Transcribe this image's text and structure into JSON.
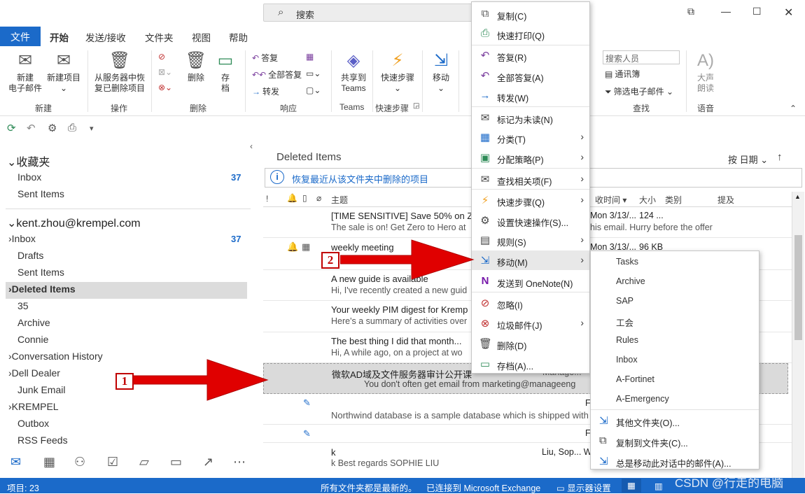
{
  "titlebar": {
    "search_placeholder": "搜索",
    "icons": [
      "magnifier-icon",
      "restore-icon",
      "minimize-icon",
      "maximize-icon",
      "close-icon"
    ]
  },
  "menu": {
    "tabs": [
      "文件",
      "开始",
      "发送/接收",
      "文件夹",
      "视图",
      "帮助"
    ],
    "active": "开始"
  },
  "ribbon": {
    "new": {
      "new_email": "新建\n电子邮件",
      "new_items": "新建项目",
      "group": "新建"
    },
    "actions": {
      "recover": "从服务器中恢\n复已删除项目",
      "group": "操作"
    },
    "delete": {
      "delete": "删除",
      "archive": "存\n档",
      "group": "删除"
    },
    "respond": {
      "reply": "答复",
      "reply_all": "全部答复",
      "forward": "转发",
      "group": "响应"
    },
    "teams": {
      "share": "共享到\nTeams",
      "group": "Teams"
    },
    "quick_steps": {
      "label": "快速步骤",
      "group": "快速步骤"
    },
    "move": {
      "label": "移动"
    },
    "find": {
      "search_people": "搜索人员",
      "address_book": "通讯簿",
      "filter": "筛选电子邮件",
      "group": "查找"
    },
    "speech": {
      "read_aloud": "大声\n朗读",
      "group": "语音"
    }
  },
  "folders": {
    "favorites_header": "收藏夹",
    "favorites": [
      {
        "label": "Inbox",
        "count": "37"
      },
      {
        "label": "Sent Items"
      }
    ],
    "account": "kent.zhou@krempel.com",
    "items": [
      {
        "label": "Inbox",
        "count": "37",
        "expand": true
      },
      {
        "label": "Drafts"
      },
      {
        "label": "Sent Items"
      },
      {
        "label": "Deleted Items",
        "expand": true,
        "selected": true
      },
      {
        "label": "35"
      },
      {
        "label": "Archive"
      },
      {
        "label": "Connie"
      },
      {
        "label": "Conversation History",
        "expand": true
      },
      {
        "label": "Dell Dealer",
        "expand": true
      },
      {
        "label": "Junk Email"
      },
      {
        "label": "KREMPEL",
        "expand": true
      },
      {
        "label": "Outbox"
      },
      {
        "label": "RSS Feeds"
      }
    ]
  },
  "mail": {
    "folder_title": "Deleted Items",
    "sort": "按 日期",
    "info": "恢复最近从该文件夹中删除的项目",
    "columns": {
      "importance": "!",
      "subject": "主题",
      "received": "收时间",
      "size": "大小",
      "category": "类别",
      "mention": "提及"
    },
    "rows": [
      {
        "subject": "[TIME SENSITIVE] Save 50% on Zero",
        "preview": "The sale is on! Get Zero to Hero at",
        "date": "Mon 3/13/...",
        "size": "124 ...",
        "tail": "his email. Hurry before the offer"
      },
      {
        "subject": "weekly meeting",
        "preview": "",
        "date": "Mon 3/13/...",
        "size": "96 KB",
        "tail": ""
      },
      {
        "subject": "A new guide is available",
        "preview": "Hi,  I've recently created a new guid",
        "date": "",
        "size": "",
        "tail": ""
      },
      {
        "subject": "Your weekly PIM digest for Kremp",
        "preview": "Here's a summary of activities over",
        "date": "",
        "size": "",
        "tail": ""
      },
      {
        "subject": "The best thing I did that month...",
        "preview": "Hi,  A while ago, on a project at wo",
        "date": "",
        "size": "",
        "tail": ""
      },
      {
        "subject": "微软AD域及文件服务器审计公开课",
        "preview": "You don't often get email from marketing@manageeng",
        "date": "",
        "size": "",
        "tail": "Manage..."
      },
      {
        "subject": "",
        "preview": "Northwind database is a sample database which is shipped with",
        "date": "",
        "size": "",
        "tail": "F"
      },
      {
        "subject": "",
        "preview": "",
        "date": "",
        "size": "",
        "tail": "F"
      },
      {
        "subject": "k",
        "preview": "k  Best regards    SOPHIE LIU",
        "date": "",
        "size": "",
        "tail": "Liu, Sop...   W"
      }
    ]
  },
  "context_menu": [
    {
      "label": "复制(C)",
      "icon": "copy-icon"
    },
    {
      "label": "快速打印(Q)",
      "icon": "print-icon"
    },
    {
      "label": "答复(R)",
      "icon": "reply-icon"
    },
    {
      "label": "全部答复(A)",
      "icon": "reply-all-icon"
    },
    {
      "label": "转发(W)",
      "icon": "forward-icon"
    },
    {
      "label": "标记为未读(N)",
      "icon": "envelope-icon"
    },
    {
      "label": "分类(T)",
      "icon": "category-icon",
      "sub": true
    },
    {
      "label": "分配策略(P)",
      "icon": "policy-icon",
      "sub": true
    },
    {
      "label": "查找相关项(F)",
      "icon": "find-related-icon",
      "sub": true
    },
    {
      "label": "快速步骤(Q)",
      "icon": "lightning-icon",
      "sub": true
    },
    {
      "label": "设置快速操作(S)...",
      "icon": "gear-icon"
    },
    {
      "label": "规则(S)",
      "icon": "rules-icon",
      "sub": true
    },
    {
      "label": "移动(M)",
      "icon": "move-icon",
      "sub": true
    },
    {
      "label": "发送到 OneNote(N)",
      "icon": "onenote-icon"
    },
    {
      "label": "忽略(I)",
      "icon": "ignore-icon"
    },
    {
      "label": "垃圾邮件(J)",
      "icon": "junk-icon",
      "sub": true
    },
    {
      "label": "删除(D)",
      "icon": "trash-icon"
    },
    {
      "label": "存档(A)...",
      "icon": "archive-icon"
    }
  ],
  "move_submenu": {
    "folders": [
      "Tasks",
      "Archive",
      "SAP",
      "工会",
      "Rules",
      "Inbox",
      "A-Fortinet",
      "A-Emergency"
    ],
    "actions": [
      "其他文件夹(O)...",
      "复制到文件夹(C)...",
      "总是移动此对话中的邮件(A)..."
    ]
  },
  "markers": {
    "one": "1",
    "two": "2"
  },
  "status": {
    "items": "项目: 23",
    "all_updated": "所有文件夹都是最新的。",
    "connected": "已连接到 Microsoft Exchange",
    "display": "显示器设置"
  },
  "watermark": "CSDN @行走的电脑",
  "colors": {
    "accent": "#1b6ac9",
    "arrow_red": "#e00000",
    "selected_bg": "#dcdcdc"
  }
}
